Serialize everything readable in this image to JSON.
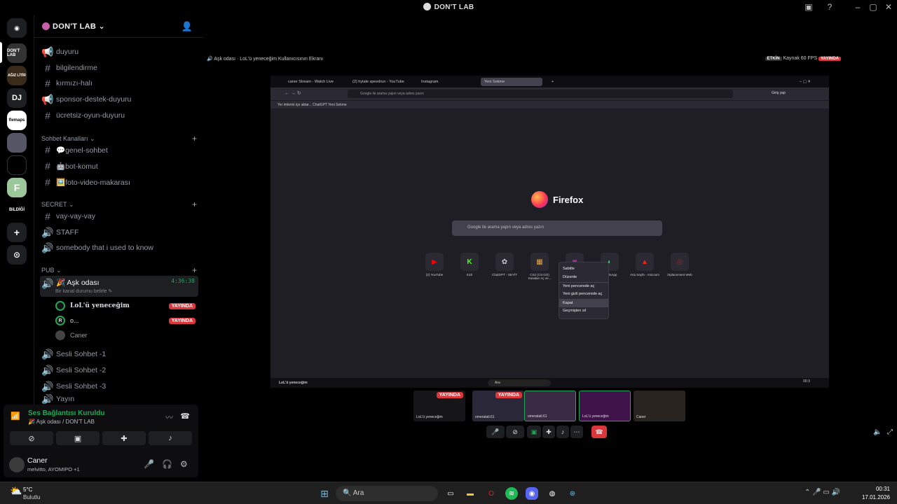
{
  "window": {
    "title": "DON'T LAB"
  },
  "rail": {
    "servers": [
      "DON'T LAB",
      "AĞIZ LİTİR",
      "DJ",
      "flemaps",
      "",
      "",
      "F",
      "BiLDİĞİ"
    ]
  },
  "guild": {
    "name": "DON'T LAB"
  },
  "channels_top": [
    "duyuru",
    "bilgilendirme",
    "kırmızı-halı",
    "sponsor-destek-duyuru",
    "ücretsiz-oyun-duyuru"
  ],
  "cat_sohbet": "Sohbet Kanalları",
  "channels_sohbet": [
    "💬genel-sohbet",
    "🤖bot-komut",
    "🖼️foto-video-makarası"
  ],
  "cat_secret": "SECRET",
  "secret_channels": [
    "vay-vay-vay",
    "STAFF",
    "somebody that i used to know"
  ],
  "cat_pub": "PUB",
  "active_voice": {
    "name": "🎉 Aşk odası",
    "timer": "4:36:38",
    "status": "Bir kanal durumu belirle"
  },
  "voice_users": [
    {
      "name": "LoL'ü yeneceğim",
      "live": "YAYINDA",
      "initial": ""
    },
    {
      "name": "o...",
      "live": "YAYINDA",
      "initial": "R"
    },
    {
      "name": "Caner",
      "live": "",
      "initial": ""
    }
  ],
  "voice_channels": [
    "Sesli Sohbet -1",
    "Sesli Sohbet -2",
    "Sesli Sohbet -3",
    "Yayın"
  ],
  "voice_panel": {
    "status": "Ses Bağlantısı Kuruldu",
    "sub": "🎉 Aşk odası / DON'T LAB"
  },
  "user": {
    "name": "Caner",
    "status": "melvitto, AYOMIPO +1"
  },
  "stream_bar": {
    "left": "🔊 Aşk odası  ·  LoL'ü yeneceğim Kullanıcısının Ekranı",
    "badge1": "ETKİN",
    "right": "Kaynak 60 FPS",
    "badge2": "YAYINDA"
  },
  "firefox": {
    "tabs": [
      "caner Stream - Watch Live",
      "(2) hytale speedrun - YouTube",
      "Instagram",
      "Yeni Sekme"
    ],
    "url_placeholder": "Google ile arama yapın veya adres yazın",
    "bookmarks": "Yer imlerini içe aktar...   ChatGPT   Yeni Sekme",
    "logo": "Firefox",
    "search_placeholder": "Google ile arama yapın veya adres yazın",
    "login": "Giriş yap",
    "tiles": [
      "(2) YouTube",
      "Kick",
      "ChatGPT - SEYİT",
      "CS2 (CS:GO) Kasaları Aç ve...",
      "",
      "WhatsApp",
      "Ana Sayfa - Anicoum",
      "iSplacement Web"
    ],
    "context_menu": [
      "Sabitle",
      "Düzenle",
      "Yeni pencerede aç",
      "Yeni gizli pencerede aç",
      "Kapat",
      "Geçmişten sil"
    ],
    "taskbar_user": "LoL'ü yeneceğim",
    "taskbar_search": "Ara",
    "clock": "00:3"
  },
  "thumbs": [
    "LoL'ü yeneceğim",
    "omeratali.61",
    "omeratali.61",
    "LoL'ü yeneceğim",
    "Caner"
  ],
  "thumb_live": "YAYINDA",
  "taskbar": {
    "weather_temp": "5°C",
    "weather_desc": "Bulutlu",
    "search": "Ara",
    "time": "00:31",
    "date": "17.01.2026"
  }
}
